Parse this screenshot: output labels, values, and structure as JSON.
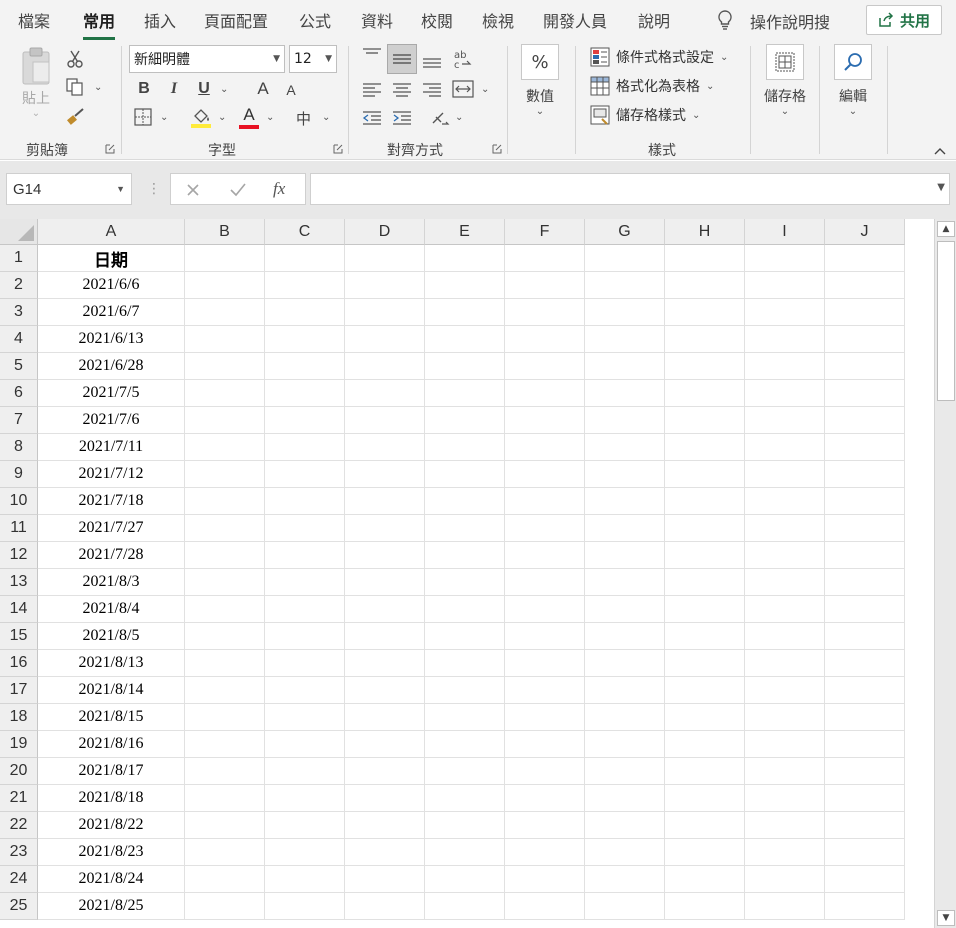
{
  "tabs": [
    {
      "label": "檔案",
      "active": false
    },
    {
      "label": "常用",
      "active": true
    },
    {
      "label": "插入",
      "active": false
    },
    {
      "label": "頁面配置",
      "active": false
    },
    {
      "label": "公式",
      "active": false
    },
    {
      "label": "資料",
      "active": false
    },
    {
      "label": "校閱",
      "active": false
    },
    {
      "label": "檢視",
      "active": false
    },
    {
      "label": "開發人員",
      "active": false
    },
    {
      "label": "說明",
      "active": false
    }
  ],
  "search_label": "操作說明搜",
  "share_label": "共用",
  "ribbon": {
    "clipboard": {
      "label": "剪貼簿",
      "paste_label": "貼上"
    },
    "font": {
      "label": "字型",
      "font_name": "新細明體",
      "font_size": "12",
      "bold": "B",
      "italic": "I",
      "underline": "U",
      "grow": "A",
      "shrink": "A",
      "font_color_glyph": "A",
      "phonetic_glyph": "中"
    },
    "alignment": {
      "label": "對齊方式"
    },
    "number": {
      "label": "數值",
      "symbol": "%"
    },
    "styles": {
      "label": "樣式",
      "conditional": "條件式格式設定",
      "format_table": "格式化為表格",
      "cell_styles": "儲存格樣式"
    },
    "cells": {
      "label": "儲存格"
    },
    "editing": {
      "label": "編輯"
    }
  },
  "formula_bar": {
    "name_box": "G14",
    "fx": "fx",
    "value": ""
  },
  "grid": {
    "columns": [
      "A",
      "B",
      "C",
      "D",
      "E",
      "F",
      "G",
      "H",
      "I",
      "J"
    ],
    "rows": [
      {
        "n": "1",
        "a": "日期"
      },
      {
        "n": "2",
        "a": "2021/6/6"
      },
      {
        "n": "3",
        "a": "2021/6/7"
      },
      {
        "n": "4",
        "a": "2021/6/13"
      },
      {
        "n": "5",
        "a": "2021/6/28"
      },
      {
        "n": "6",
        "a": "2021/7/5"
      },
      {
        "n": "7",
        "a": "2021/7/6"
      },
      {
        "n": "8",
        "a": "2021/7/11"
      },
      {
        "n": "9",
        "a": "2021/7/12"
      },
      {
        "n": "10",
        "a": "2021/7/18"
      },
      {
        "n": "11",
        "a": "2021/7/27"
      },
      {
        "n": "12",
        "a": "2021/7/28"
      },
      {
        "n": "13",
        "a": "2021/8/3"
      },
      {
        "n": "14",
        "a": "2021/8/4"
      },
      {
        "n": "15",
        "a": "2021/8/5"
      },
      {
        "n": "16",
        "a": "2021/8/13"
      },
      {
        "n": "17",
        "a": "2021/8/14"
      },
      {
        "n": "18",
        "a": "2021/8/15"
      },
      {
        "n": "19",
        "a": "2021/8/16"
      },
      {
        "n": "20",
        "a": "2021/8/17"
      },
      {
        "n": "21",
        "a": "2021/8/18"
      },
      {
        "n": "22",
        "a": "2021/8/22"
      },
      {
        "n": "23",
        "a": "2021/8/23"
      },
      {
        "n": "24",
        "a": "2021/8/24"
      },
      {
        "n": "25",
        "a": "2021/8/25"
      }
    ]
  },
  "colors": {
    "accent": "#217346",
    "font_color": "#e81123",
    "highlight": "#ffeb3b"
  }
}
